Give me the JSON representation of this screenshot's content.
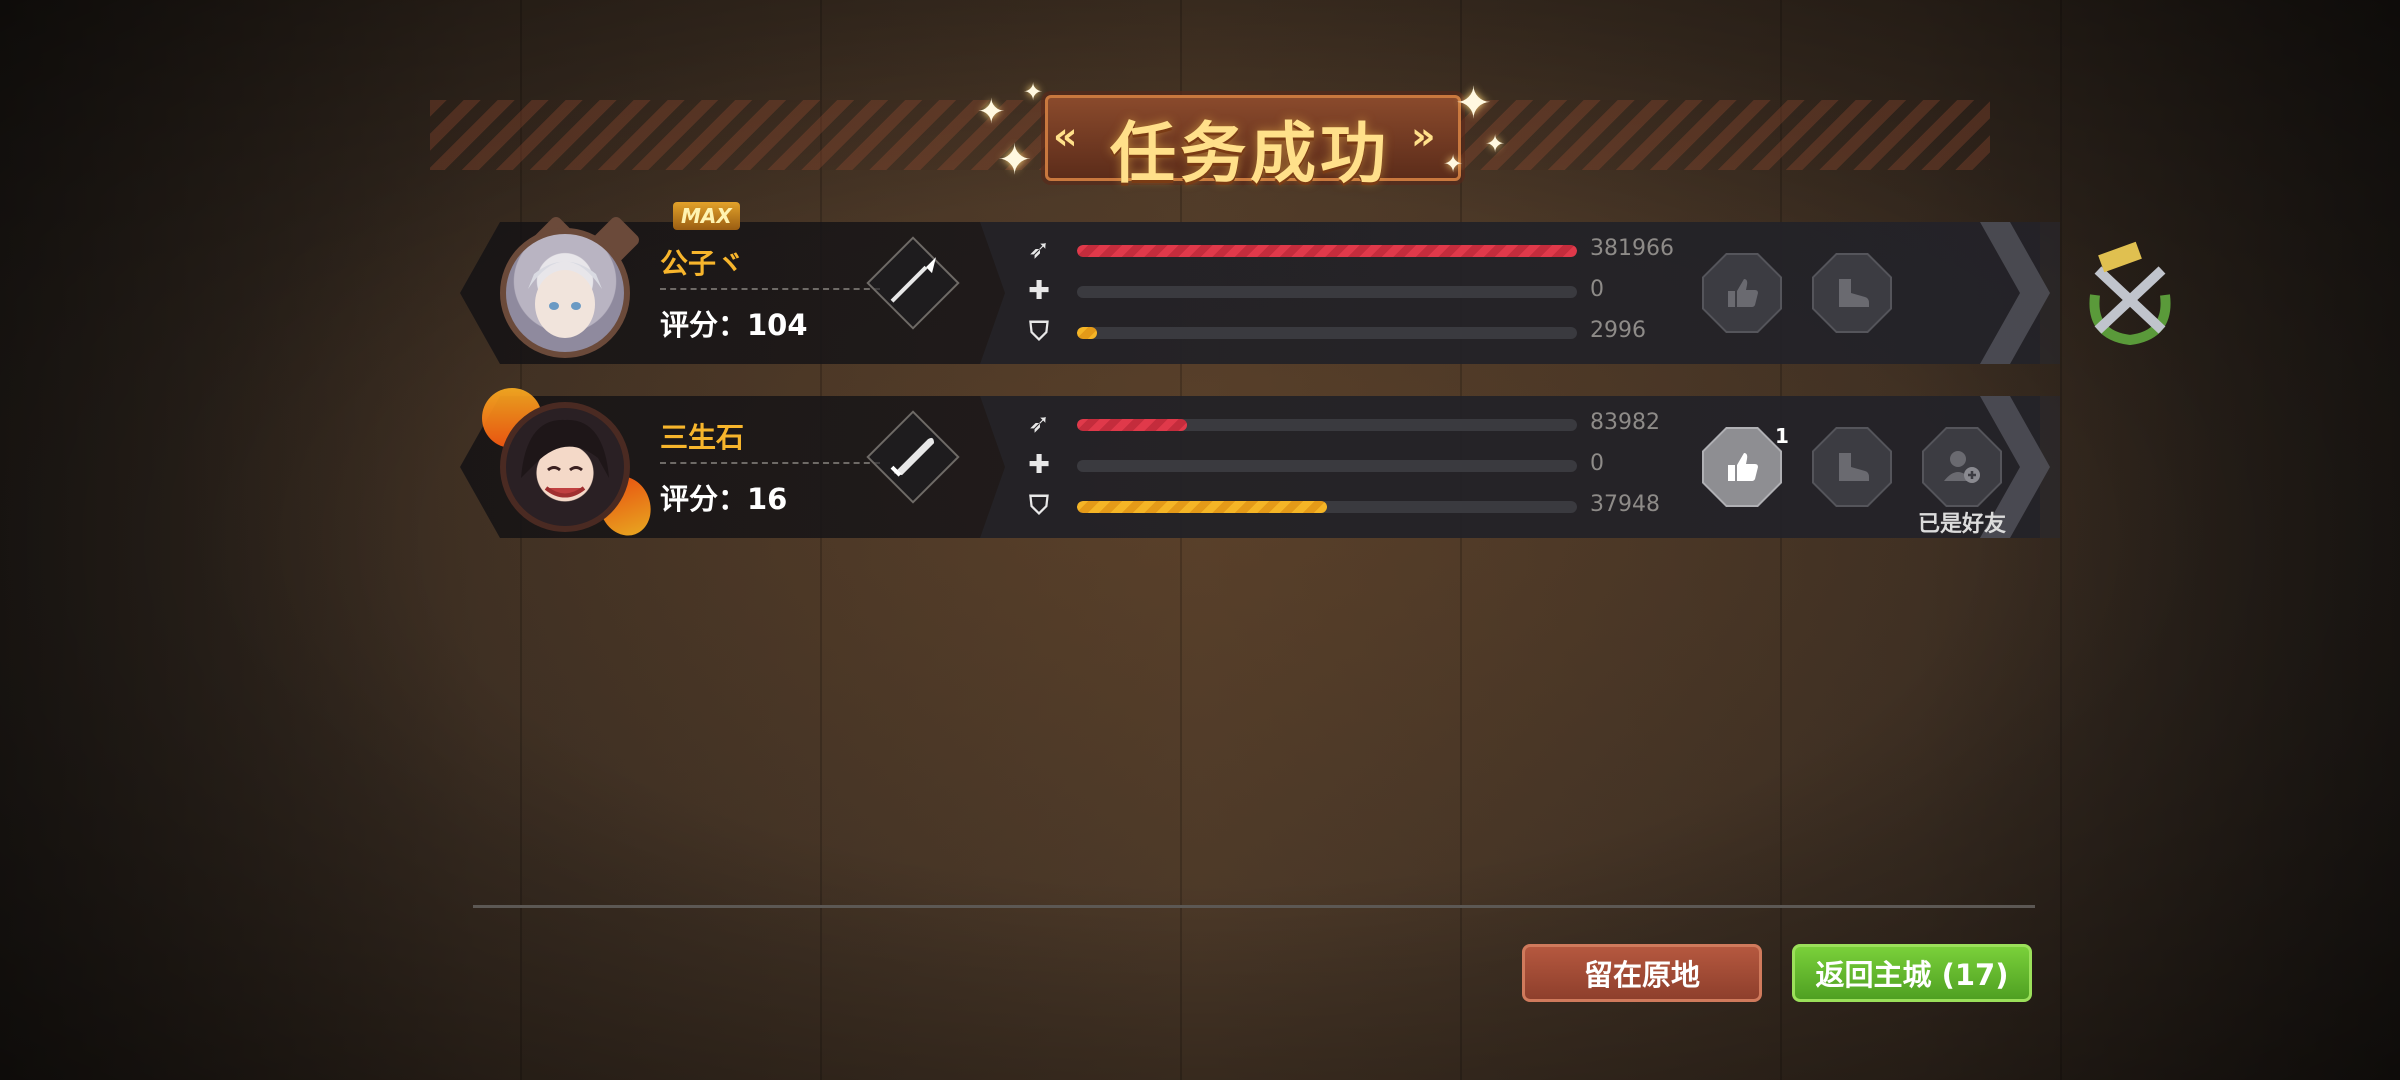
{
  "header": {
    "title": "任务成功"
  },
  "players": [
    {
      "name": "公子ヾ",
      "badge": "MAX",
      "score_text": "评分：104",
      "weapon_icon": "spear-icon",
      "stats": [
        {
          "icon": "damage-icon",
          "color": "red",
          "fraction": 1.0,
          "value": "381966"
        },
        {
          "icon": "heal-icon",
          "color": "green",
          "fraction": 0.0,
          "value": "0"
        },
        {
          "icon": "tank-icon",
          "color": "yellow",
          "fraction": 0.04,
          "value": "2996"
        }
      ],
      "like_count": "",
      "friend_label": ""
    },
    {
      "name": "三生石",
      "badge": "",
      "score_text": "评分：16",
      "weapon_icon": "sword-icon",
      "stats": [
        {
          "icon": "damage-icon",
          "color": "red",
          "fraction": 0.22,
          "value": "83982"
        },
        {
          "icon": "heal-icon",
          "color": "green",
          "fraction": 0.0,
          "value": "0"
        },
        {
          "icon": "tank-icon",
          "color": "yellow",
          "fraction": 0.5,
          "value": "37948"
        }
      ],
      "like_count": "1",
      "friend_label": "已是好友"
    }
  ],
  "buttons": {
    "stay": "留在原地",
    "return": "返回主城 (17)"
  },
  "colors": {
    "name": "#f7b52c",
    "bar_red": "#e0394a",
    "bar_yellow": "#f5b526",
    "btn_stay": "#a54a34",
    "btn_return": "#66bb2e"
  }
}
